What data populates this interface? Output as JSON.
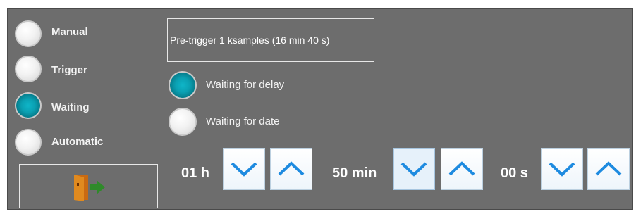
{
  "modes": [
    {
      "label": "Manual",
      "selected": false
    },
    {
      "label": "Trigger",
      "selected": false
    },
    {
      "label": "Waiting",
      "selected": true
    },
    {
      "label": "Automatic",
      "selected": false
    }
  ],
  "pretrigger_text": "Pre-trigger 1 ksamples (16 min 40 s)",
  "wait_options": [
    {
      "label": "Waiting for delay",
      "selected": true
    },
    {
      "label": "Waiting for date",
      "selected": false
    }
  ],
  "time": {
    "hours": "01 h",
    "minutes": "50 min",
    "seconds": "00 s"
  },
  "icons": {
    "exit": "exit-door-icon",
    "down": "chevron-down-icon",
    "up": "chevron-up-icon"
  },
  "colors": {
    "panel_bg": "#6d6d6d",
    "accent": "#0aa0b2",
    "chevron": "#1e8be0"
  }
}
